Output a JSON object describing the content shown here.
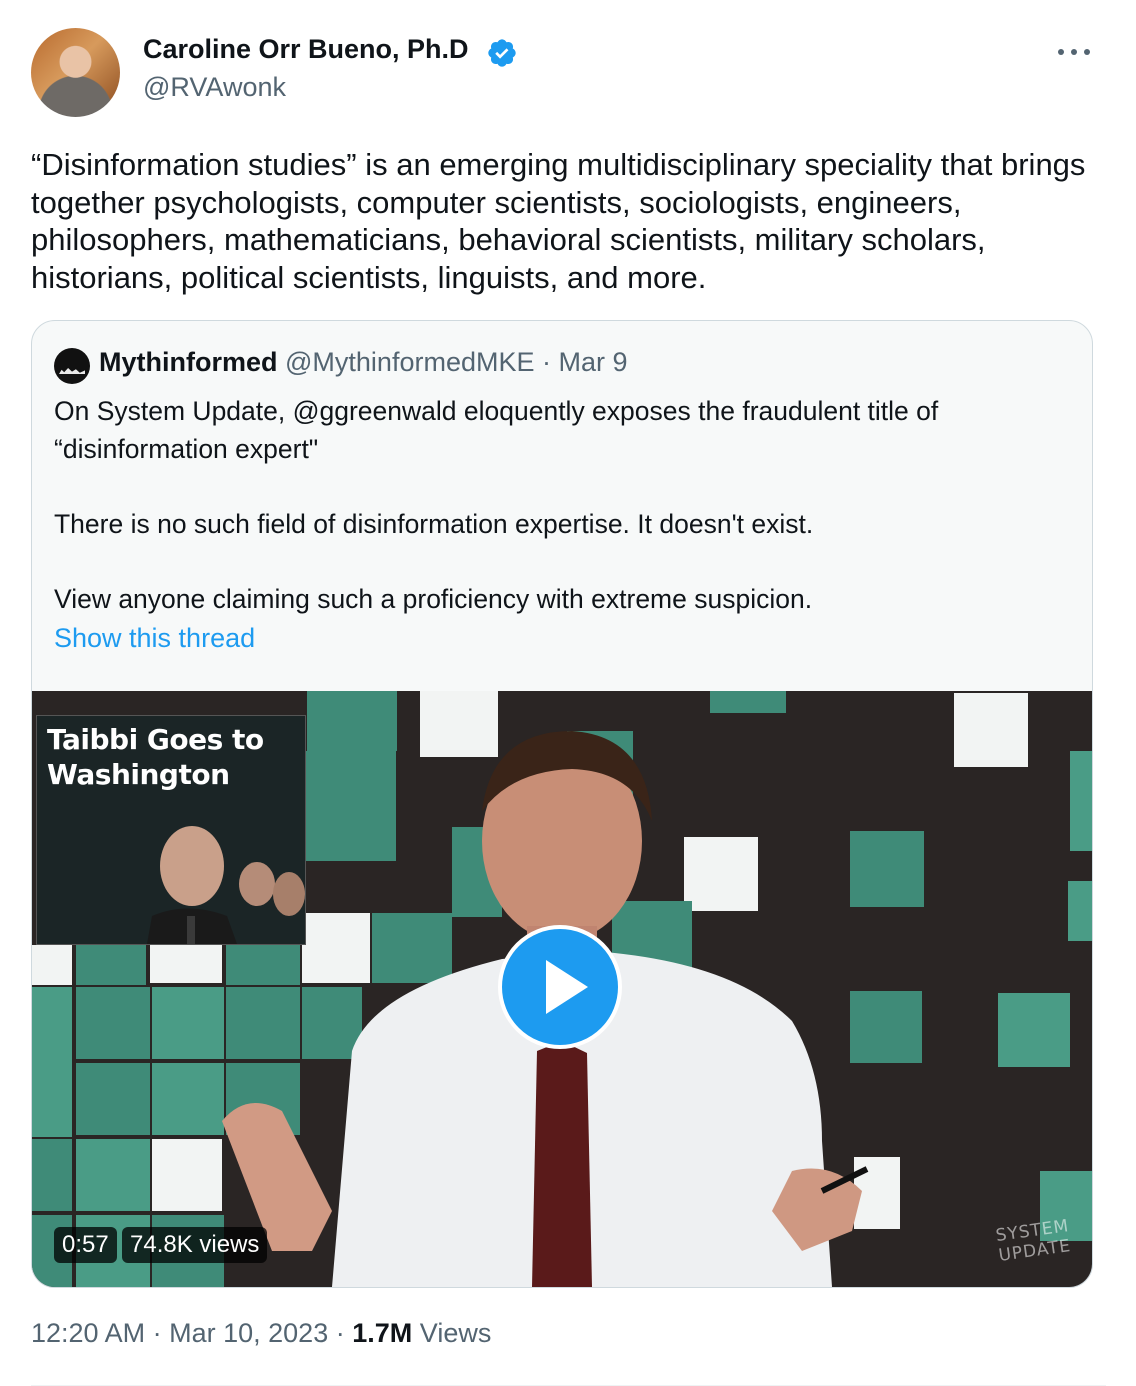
{
  "author": {
    "name": "Caroline Orr Bueno, Ph.D",
    "handle": "@RVAwonk",
    "verified": true
  },
  "tweet": {
    "text": "“Disinformation studies” is an emerging multidisciplinary speciality that brings together psychologists, computer scientists, sociologists, engineers, philosophers, mathematicians, behavioral scientists, military scholars, historians, political scientists, linguists, and more."
  },
  "quote": {
    "name": "Mythinformed",
    "handle": "@MythinformedMKE",
    "date": "Mar 9",
    "line1": "On System Update, @ggreenwald eloquently exposes the fraudulent title of “disinformation expert\"",
    "line2": "There is no such field of disinformation expertise.  It doesn't exist.",
    "line3": "View anyone claiming such a proficiency with extreme suspicion.",
    "show_thread": "Show this thread",
    "video": {
      "inset_title": "Taibbi Goes to Washington",
      "duration": "0:57",
      "views": "74.8K views",
      "watermark_line1": "SYSTEM",
      "watermark_line2": "UPDATE"
    }
  },
  "footer": {
    "time": "12:20 AM",
    "separator": "·",
    "date": "Mar 10, 2023",
    "view_count": "1.7M",
    "views_label": "Views"
  },
  "colors": {
    "accent": "#1d9bf0",
    "text": "#0f1419",
    "muted": "#536471",
    "border": "#cfd9de"
  }
}
